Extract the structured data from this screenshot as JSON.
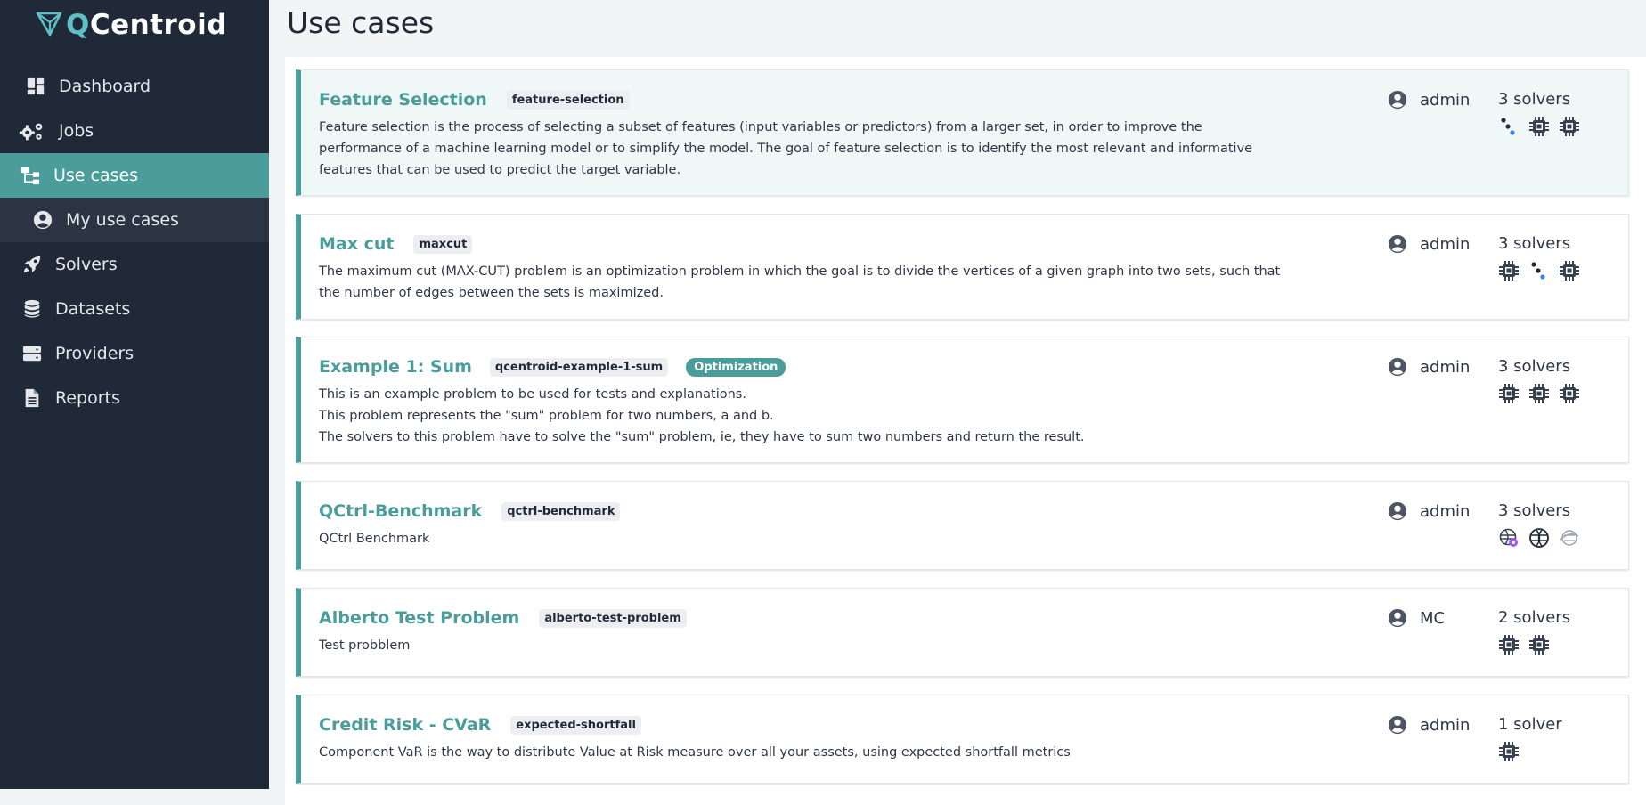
{
  "app": {
    "logo_q": "Q",
    "logo_rest": "Centroid"
  },
  "page": {
    "title": "Use cases"
  },
  "sidebar": {
    "items": [
      {
        "label": "Dashboard",
        "icon": "dashboard-icon"
      },
      {
        "label": "Jobs",
        "icon": "gears-icon"
      },
      {
        "label": "Use cases",
        "icon": "sitemap-icon",
        "active": true
      },
      {
        "label": "My use cases",
        "icon": "user-circle-icon",
        "sub": true
      },
      {
        "label": "Solvers",
        "icon": "rocket-icon"
      },
      {
        "label": "Datasets",
        "icon": "database-icon"
      },
      {
        "label": "Providers",
        "icon": "server-icon"
      },
      {
        "label": "Reports",
        "icon": "file-icon"
      }
    ]
  },
  "use_cases": [
    {
      "title": "Feature Selection",
      "slug": "feature-selection",
      "description": "Feature selection is the process of selecting a subset of features (input variables or predictors) from a larger set, in order to improve the performance of a machine learning model or to simplify the model. The goal of feature selection is to identify the most relevant and informative features that can be used to predict the target variable.",
      "owner": "admin",
      "solvers_count": "3 solvers",
      "solver_icons": [
        "dots-icon",
        "chip-icon",
        "chip-icon"
      ]
    },
    {
      "title": "Max cut",
      "slug": "maxcut",
      "description": "The maximum cut (MAX-CUT) problem is an optimization problem in which the goal is to divide the vertices of a given graph into two sets, such that the number of edges between the sets is maximized.",
      "owner": "admin",
      "solvers_count": "3 solvers",
      "solver_icons": [
        "chip-icon",
        "dots-icon",
        "chip-icon"
      ]
    },
    {
      "title": "Example 1: Sum",
      "slug": "qcentroid-example-1-sum",
      "tag": "Optimization",
      "description_lines": [
        "This is an example problem to be used for tests and explanations.",
        "This problem represents the \"sum\" problem for two numbers, a and b.",
        "The solvers to this problem have to solve the \"sum\" problem, ie, they have to sum two numbers and return the result."
      ],
      "owner": "admin",
      "solvers_count": "3 solvers",
      "solver_icons": [
        "chip-icon",
        "chip-icon",
        "chip-icon"
      ]
    },
    {
      "title": "QCtrl-Benchmark",
      "slug": "qctrl-benchmark",
      "description": "QCtrl Benchmark",
      "owner": "admin",
      "solvers_count": "3 solvers",
      "solver_icons": [
        "globe-badge-icon",
        "globe-icon",
        "globe-faded-icon"
      ]
    },
    {
      "title": "Alberto Test Problem",
      "slug": "alberto-test-problem",
      "description": "Test probblem",
      "owner": "MC",
      "solvers_count": "2 solvers",
      "solver_icons": [
        "chip-icon",
        "chip-icon"
      ]
    },
    {
      "title": "Credit Risk - CVaR",
      "slug": "expected-shortfall",
      "description": "Component VaR is the way to distribute Value at Risk measure over all your assets, using expected shortfall metrics",
      "owner": "admin",
      "solvers_count": "1 solver",
      "solver_icons": [
        "chip-icon"
      ]
    }
  ],
  "colors": {
    "accent": "#4a9d9a",
    "sidebar": "#1f2937",
    "logo_q": "#5fbfc5",
    "badge_purple": "#a855f7"
  }
}
